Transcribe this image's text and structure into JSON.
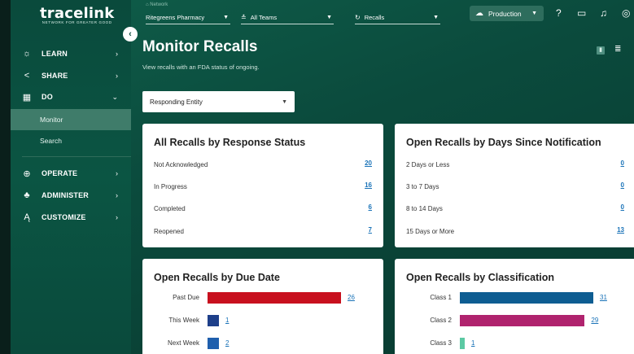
{
  "logo": {
    "name": "tracelink",
    "tagline": "NETWORK FOR GREATER GOOD"
  },
  "sidebar": {
    "collapse_icon": "chevron-left-icon",
    "items": [
      {
        "label": "LEARN",
        "icon": "lightbulb-icon"
      },
      {
        "label": "SHARE",
        "icon": "share-icon"
      },
      {
        "label": "DO",
        "icon": "grid-icon"
      },
      {
        "label": "OPERATE",
        "icon": "globe-icon"
      },
      {
        "label": "ADMINISTER",
        "icon": "user-gear-icon"
      },
      {
        "label": "CUSTOMIZE",
        "icon": "customize-icon"
      }
    ],
    "sub_items": [
      {
        "label": "Monitor",
        "active": true
      },
      {
        "label": "Search",
        "active": false
      }
    ]
  },
  "topbar": {
    "network_label": "Network",
    "network_value": "Ritegreens Pharmacy",
    "team_value": "All Teams",
    "app_value": "Recalls",
    "environment": "Production"
  },
  "page": {
    "title": "Monitor Recalls",
    "subtitle": "View recalls with an FDA status of ongoing.",
    "filter_value": "Responding Entity"
  },
  "cards": {
    "status": {
      "title": "All Recalls by Response Status",
      "rows": [
        {
          "label": "Not Acknowledged",
          "value": "20"
        },
        {
          "label": "In Progress",
          "value": "16"
        },
        {
          "label": "Completed",
          "value": "6"
        },
        {
          "label": "Reopened",
          "value": "7"
        }
      ]
    },
    "days": {
      "title": "Open Recalls by Days Since Notification",
      "rows": [
        {
          "label": "2 Days or Less",
          "value": "0"
        },
        {
          "label": "3 to 7 Days",
          "value": "0"
        },
        {
          "label": "8 to 14 Days",
          "value": "0"
        },
        {
          "label": "15 Days or More",
          "value": "13"
        }
      ]
    },
    "due": {
      "title": "Open Recalls by Due Date",
      "bars": [
        {
          "label": "Past Due",
          "value": 26,
          "color": "#c8101e"
        },
        {
          "label": "This Week",
          "value": 1,
          "color": "#1e3f8a"
        },
        {
          "label": "Next Week",
          "value": 2,
          "color": "#1f5fad"
        }
      ]
    },
    "classification": {
      "title": "Open Recalls by Classification",
      "bars": [
        {
          "label": "Class 1",
          "value": 31,
          "color": "#0e5d92"
        },
        {
          "label": "Class 2",
          "value": 29,
          "color": "#b0236e"
        },
        {
          "label": "Class 3",
          "value": 1,
          "color": "#5cc9a3"
        }
      ]
    }
  }
}
